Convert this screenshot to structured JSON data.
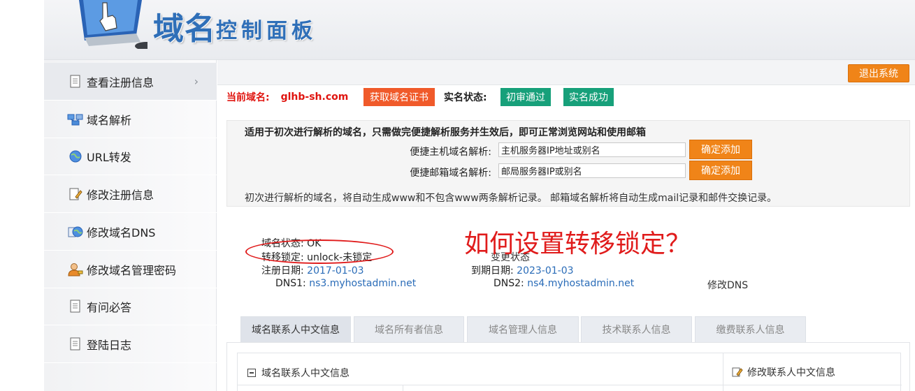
{
  "header": {
    "brand_big": "域名",
    "brand_small": "控制面板"
  },
  "sidebar": {
    "items": [
      {
        "label": "查看注册信息",
        "icon": "document-icon"
      },
      {
        "label": "域名解析",
        "icon": "network-icon"
      },
      {
        "label": "URL转发",
        "icon": "globe-icon"
      },
      {
        "label": "修改注册信息",
        "icon": "edit-document-icon"
      },
      {
        "label": "修改域名DNS",
        "icon": "dns-globe-icon"
      },
      {
        "label": "修改域名管理密码",
        "icon": "user-key-icon"
      },
      {
        "label": "有问必答",
        "icon": "document-icon"
      },
      {
        "label": "登陆日志",
        "icon": "document-icon"
      }
    ],
    "arrow": "›"
  },
  "toolbar": {
    "logout_label": "退出系统"
  },
  "domain_bar": {
    "label": "当前域名:",
    "value": "glhb-sh.com",
    "cert_button": "获取域名证书",
    "real_name_label": "实名状态:",
    "status_1": "初审通过",
    "status_2": "实名成功"
  },
  "quick": {
    "title": "适用于初次进行解析的域名，只需做完便捷解析服务并生效后，即可正常浏览网站和使用邮箱",
    "host_label": "便捷主机域名解析:",
    "host_placeholder": "主机服务器IP地址或别名",
    "mail_label": "便捷邮箱域名解析:",
    "mail_placeholder": "邮局服务器IP或别名",
    "add_label": "确定添加",
    "note": "初次进行解析的域名，将自动生成www和不包含www两条解析记录。 邮箱域名解析将自动生成mail记录和邮件交换记录。"
  },
  "info": {
    "status_label": "域名状态:",
    "status_value": "OK",
    "lock_label": "转移锁定:",
    "lock_value": "unlock-未锁定",
    "change_status": "变更状态",
    "reg_label": "注册日期:",
    "reg_value": "2017-01-03",
    "exp_label": "到期日期:",
    "exp_value": "2023-01-03",
    "dns1_label": "DNS1:",
    "dns1_value": "ns3.myhostadmin.net",
    "dns2_label": "DNS2:",
    "dns2_value": "ns4.myhostadmin.net",
    "modify_dns": "修改DNS"
  },
  "annotation": {
    "question": "如何设置转移锁定？",
    "color": "#e01b1b"
  },
  "tabs": [
    {
      "label": "域名联系人中文信息"
    },
    {
      "label": "域名所有者信息"
    },
    {
      "label": "域名管理人信息"
    },
    {
      "label": "技术联系人信息"
    },
    {
      "label": "缴费联系人信息"
    }
  ],
  "panel": {
    "title": "域名联系人中文信息",
    "edit_label": "修改联系人中文信息"
  },
  "colors": {
    "accent_orange": "#f08418",
    "green": "#17a07a",
    "red": "#e0140f",
    "link_blue": "#2a6cb8"
  }
}
